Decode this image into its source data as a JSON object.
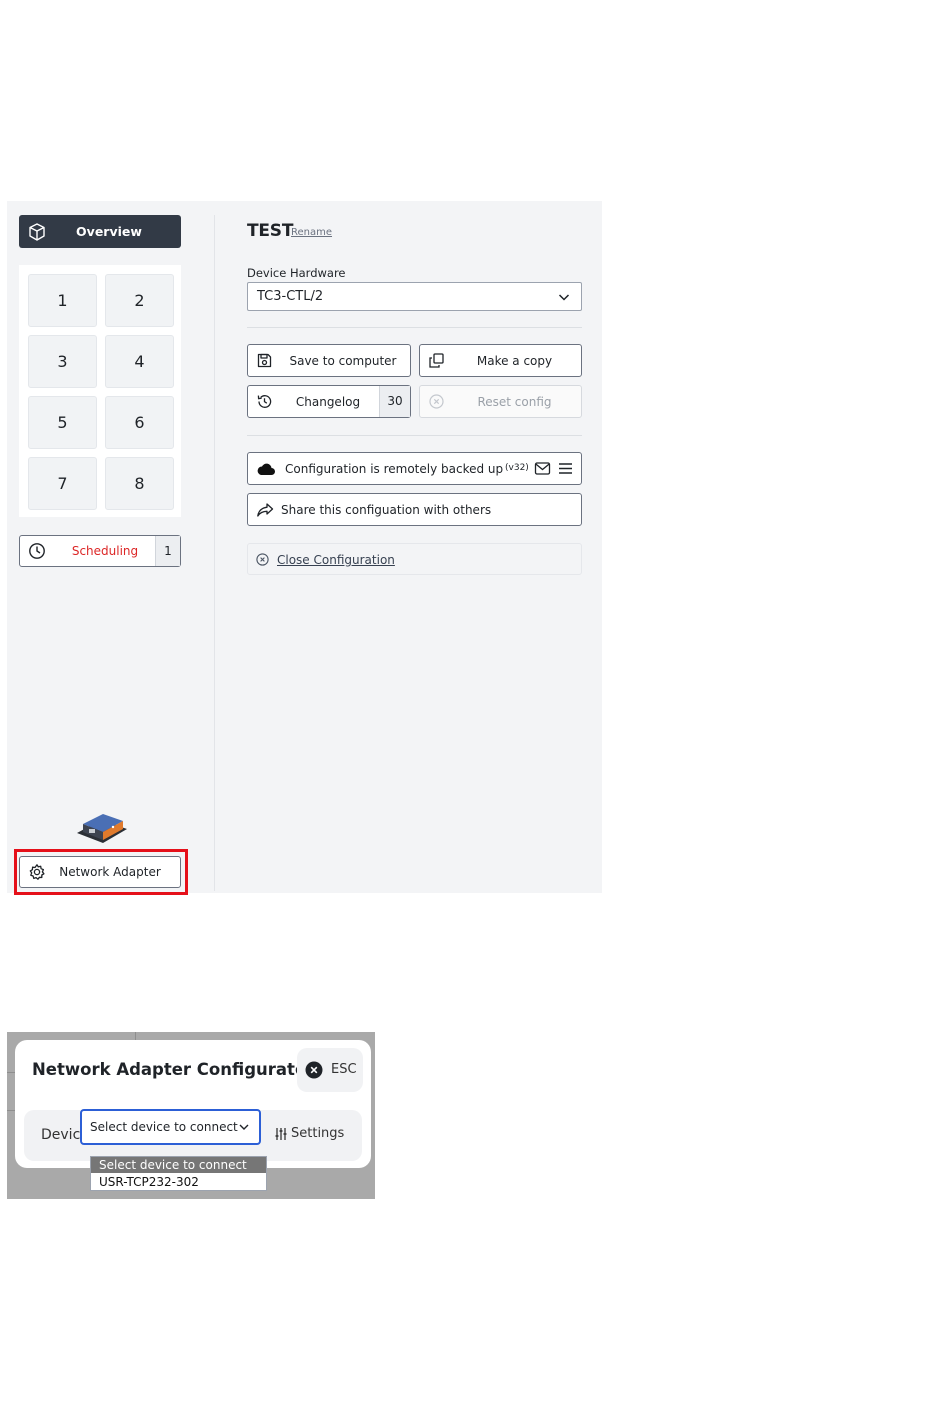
{
  "sidebar": {
    "overview_label": "Overview",
    "grid": [
      "1",
      "2",
      "3",
      "4",
      "5",
      "6",
      "7",
      "8"
    ],
    "scheduling_label": "Scheduling",
    "scheduling_count": "1",
    "network_adapter_label": "Network Adapter"
  },
  "config": {
    "title": "TEST",
    "rename_link": "Rename",
    "hardware_label": "Device Hardware",
    "hardware_value": "TC3-CTL/2",
    "save_label": "Save to computer",
    "copy_label": "Make a copy",
    "changelog_label": "Changelog",
    "changelog_count": "30",
    "reset_label": "Reset config",
    "backup_label": "Configuration is remotely backed up",
    "backup_version": "(v32)",
    "share_label": "Share this configuation with others",
    "close_label": "Close Configuration"
  },
  "dialog": {
    "title": "Network Adapter Configurator",
    "esc_label": "ESC",
    "device_label": "Device",
    "device_select_value": "Select device to connect",
    "settings_label": "Settings",
    "options": [
      "Select device to connect",
      "USR-TCP232-302"
    ]
  },
  "colors": {
    "accent_dark": "#323a46",
    "scheduling_red": "#dc2626",
    "highlight_red": "#e5101a",
    "select_focus_blue": "#2c5fd6"
  }
}
